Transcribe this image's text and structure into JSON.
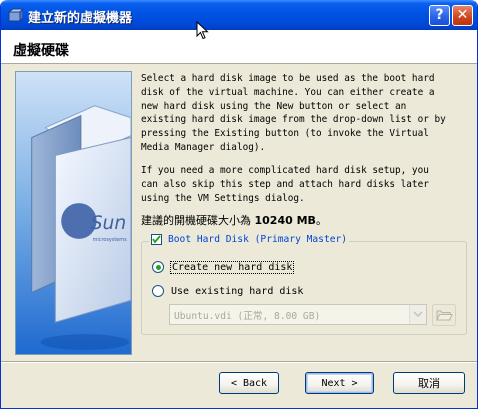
{
  "window": {
    "title": "建立新的虛擬機器",
    "help_label": "?",
    "close_label": "✕"
  },
  "page": {
    "header": "虛擬硬碟",
    "description_1": "Select a hard disk image to be used as the boot hard\ndisk of the virtual machine. You can either create a\nnew hard disk using the New button or select an\nexisting hard disk image from the drop-down list or by\npressing the Existing button (to invoke the Virtual\nMedia Manager dialog).",
    "description_2": "If you need a more complicated hard disk setup, you\ncan also skip this step and attach hard disks later\nusing the VM Settings dialog.",
    "recommended_prefix": "建議的開機硬碟大小為",
    "recommended_value": "10240 MB",
    "recommended_suffix": "。"
  },
  "boot_disk": {
    "label": "Boot Hard Disk (Primary Master)",
    "checked": true,
    "create_new_label": "Create new hard disk",
    "use_existing_label": "Use existing hard disk",
    "selected_option": "create_new",
    "existing_combo_value": "Ubuntu.vdi (正常, 8.00 GB)"
  },
  "buttons": {
    "back": "< Back",
    "next": "Next >",
    "cancel": "取消"
  },
  "image": {
    "brand_text": "Sun",
    "brand_subtext": "microsystems"
  },
  "icons": {
    "title_icon": "virtualbox-icon",
    "folder": "open-folder-icon"
  },
  "colors": {
    "titlebar": "#0055e5",
    "dialog_bg": "#ece9d8",
    "link_blue": "#0046d5",
    "radio_dot": "#21a121"
  }
}
